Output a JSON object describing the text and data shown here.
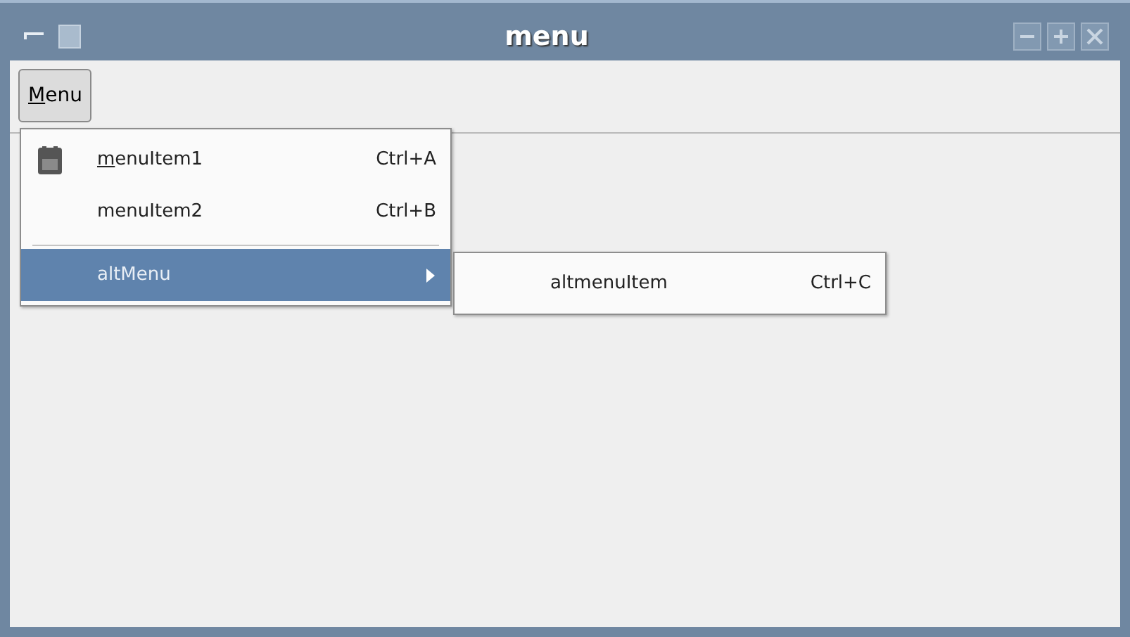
{
  "window": {
    "title": "menu"
  },
  "menubar": [
    {
      "label": "Menu",
      "mnemonic_first": true,
      "selected": true
    }
  ],
  "menu": {
    "items": [
      {
        "kind": "item",
        "label": "menuItem1",
        "mnemonic_first": true,
        "shortcut": "Ctrl+A",
        "has_icon": true,
        "selected": false
      },
      {
        "kind": "item",
        "label": "menuItem2",
        "mnemonic_first": false,
        "shortcut": "Ctrl+B",
        "has_icon": false,
        "selected": false
      },
      {
        "kind": "separator"
      },
      {
        "kind": "submenu",
        "label": "altMenu",
        "mnemonic_first": false,
        "selected": true
      }
    ]
  },
  "submenu": {
    "items": [
      {
        "kind": "item",
        "label": "altmenuItem",
        "mnemonic_first": false,
        "shortcut": "Ctrl+C",
        "has_icon": false,
        "selected": false
      }
    ]
  }
}
